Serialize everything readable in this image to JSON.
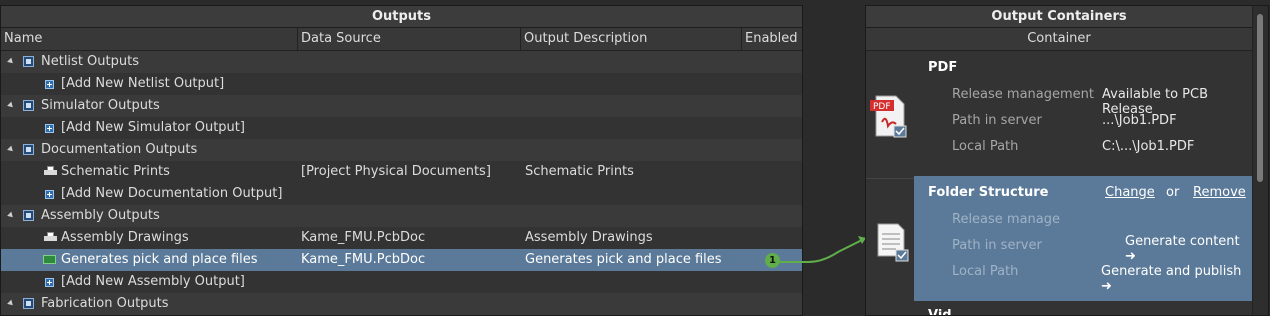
{
  "outputs": {
    "title": "Outputs",
    "columns": {
      "name": "Name",
      "source": "Data Source",
      "description": "Output Description",
      "enabled": "Enabled"
    },
    "rows": [
      {
        "name": "Netlist Outputs",
        "source": "",
        "description": "",
        "type": "group"
      },
      {
        "name": "[Add New Netlist Output]",
        "source": "",
        "description": "",
        "type": "add"
      },
      {
        "name": "Simulator Outputs",
        "source": "",
        "description": "",
        "type": "group"
      },
      {
        "name": "[Add New Simulator Output]",
        "source": "",
        "description": "",
        "type": "add"
      },
      {
        "name": "Documentation Outputs",
        "source": "",
        "description": "",
        "type": "group"
      },
      {
        "name": "Schematic Prints",
        "source": "[Project Physical Documents]",
        "description": "Schematic Prints",
        "type": "print"
      },
      {
        "name": "[Add New Documentation Output]",
        "source": "",
        "description": "",
        "type": "add"
      },
      {
        "name": "Assembly Outputs",
        "source": "",
        "description": "",
        "type": "group"
      },
      {
        "name": "Assembly Drawings",
        "source": "Kame_FMU.PcbDoc",
        "description": "Assembly Drawings",
        "type": "print"
      },
      {
        "name": "Generates pick and place files",
        "source": "Kame_FMU.PcbDoc",
        "description": "Generates pick and place files",
        "type": "pnp",
        "selected": true,
        "enabled_badge": "1"
      },
      {
        "name": "[Add New Assembly Output]",
        "source": "",
        "description": "",
        "type": "add"
      },
      {
        "name": "Fabrication Outputs",
        "source": "",
        "description": "",
        "type": "group"
      }
    ]
  },
  "containers": {
    "title": "Output Containers",
    "column": "Container",
    "pdf": {
      "title": "PDF",
      "icon": "pdf-file-icon",
      "icon_text": "PDF",
      "props": [
        {
          "label": "Release management",
          "value": "Available to PCB Release"
        },
        {
          "label": "Path in server",
          "value": "...\\Job1.PDF"
        },
        {
          "label": "Local Path",
          "value": "C:\\...\\Job1.PDF"
        }
      ]
    },
    "folder": {
      "title": "Folder Structure",
      "change": "Change",
      "or": "or",
      "remove": "Remove",
      "props": [
        {
          "label": "Release manage"
        },
        {
          "label": "Path in server"
        },
        {
          "label": "Local Path"
        }
      ],
      "generate_content": "Generate content",
      "generate_publish": "Generate and publish",
      "arrow": "➜"
    },
    "next_title": "Vid"
  },
  "colors": {
    "selected": "#5b7a99",
    "connector": "#5fae4a"
  }
}
